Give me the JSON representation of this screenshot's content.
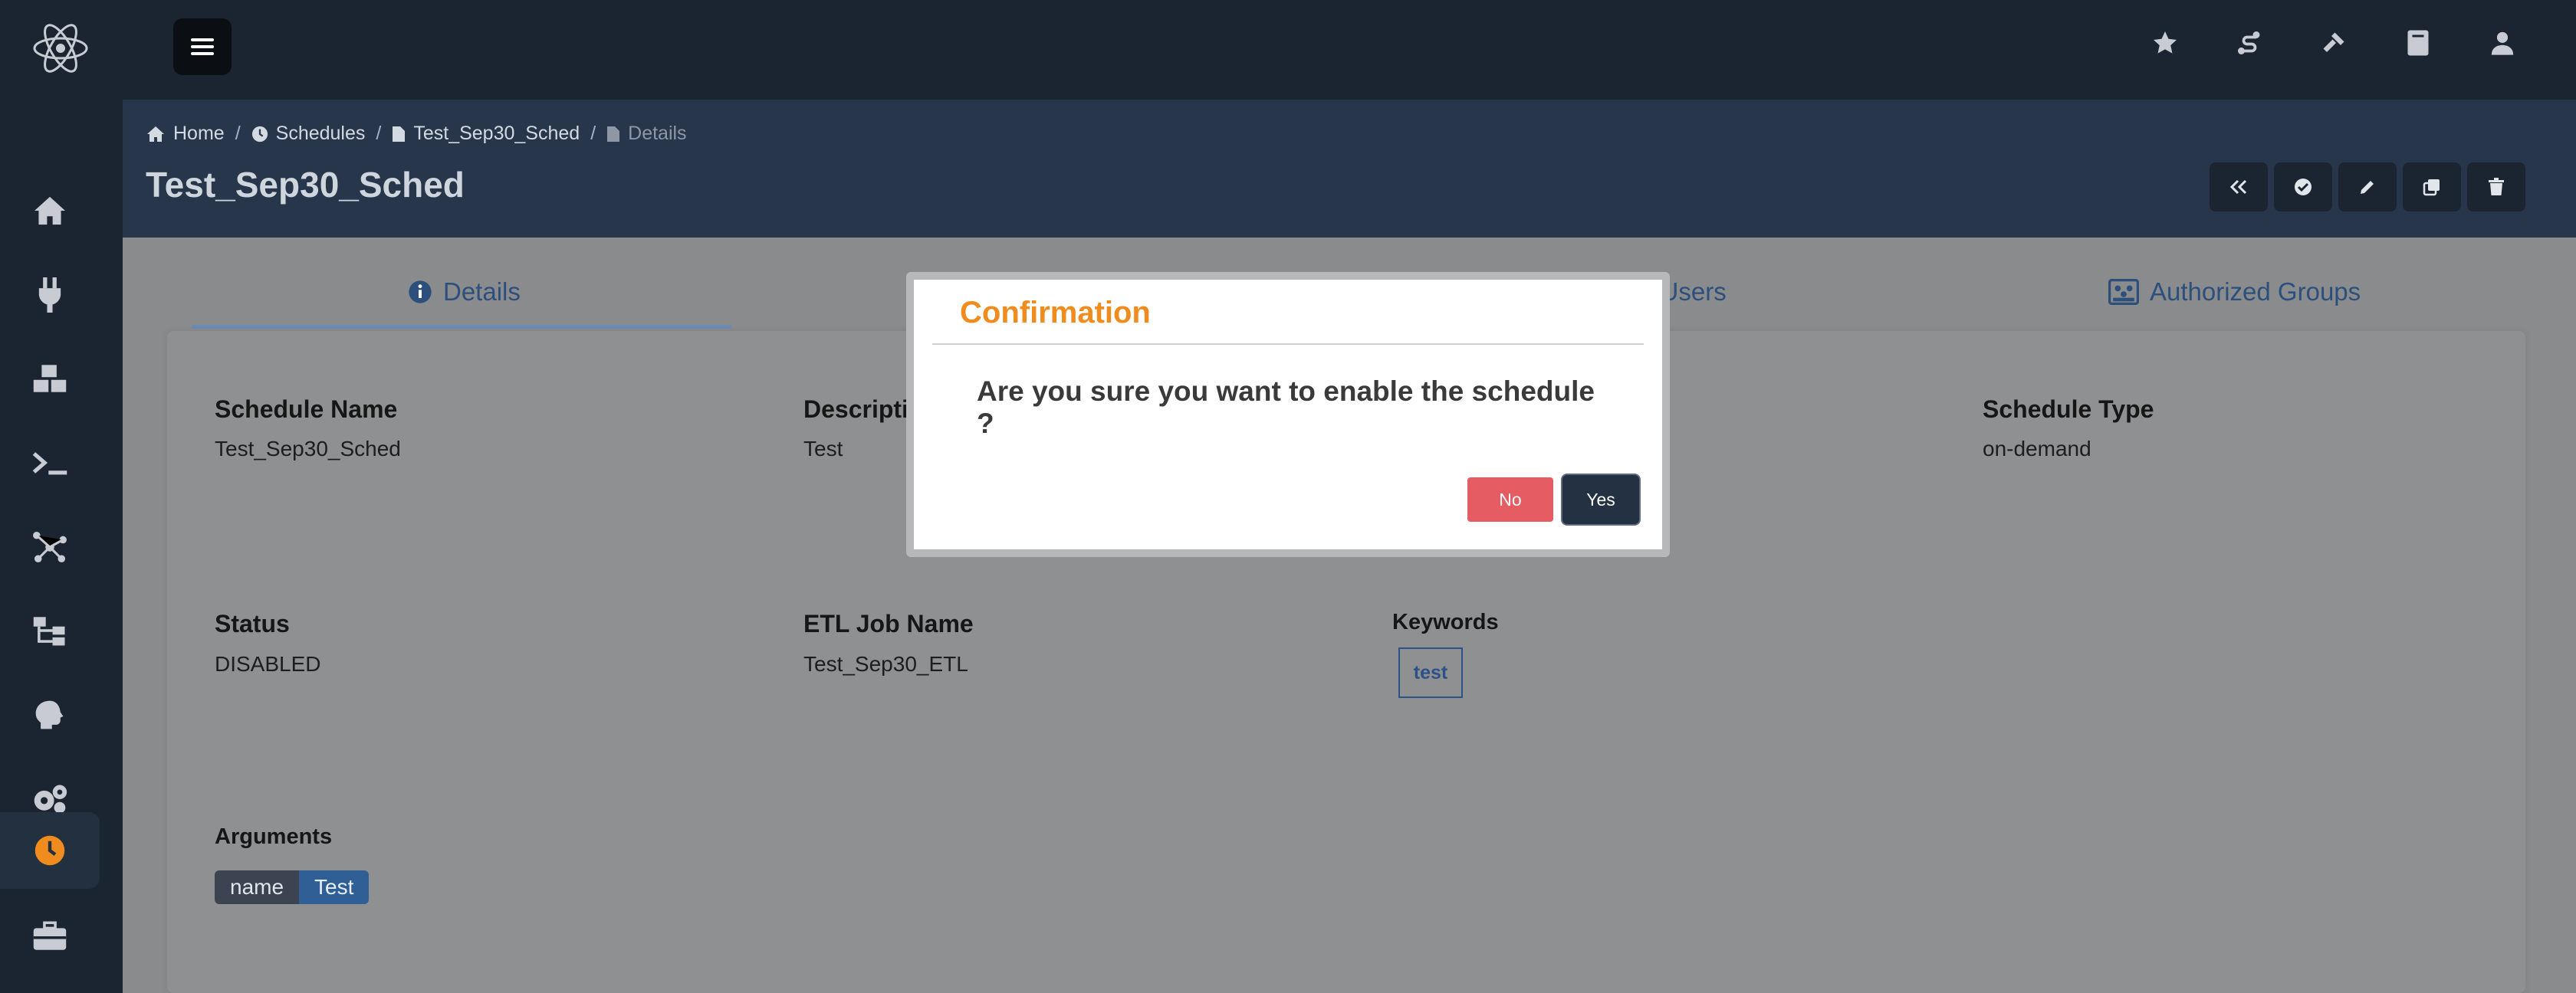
{
  "breadcrumb": {
    "home": "Home",
    "schedules": "Schedules",
    "schedule_name": "Test_Sep30_Sched",
    "current": "Details"
  },
  "page": {
    "title": "Test_Sep30_Sched"
  },
  "tabs": [
    {
      "label": "Details",
      "icon": "info-circle-icon",
      "active": true
    },
    {
      "label": "d Users",
      "icon": "users-icon"
    },
    {
      "label": "Authorized Groups",
      "icon": "groups-icon"
    }
  ],
  "fields": {
    "schedule_name": {
      "label": "Schedule Name",
      "value": "Test_Sep30_Sched"
    },
    "description": {
      "label": "Descripti",
      "value": "Test"
    },
    "schedule_type": {
      "label": "Schedule Type",
      "value": "on-demand"
    },
    "status": {
      "label": "Status",
      "value": "DISABLED"
    },
    "etl_job_name": {
      "label": "ETL Job Name",
      "value": "Test_Sep30_ETL"
    },
    "keywords": {
      "label": "Keywords",
      "items": [
        "test"
      ]
    },
    "arguments": {
      "label": "Arguments",
      "items": [
        {
          "name": "name",
          "value": "Test"
        }
      ]
    }
  },
  "modal": {
    "title": "Confirmation",
    "message_line1": "Are you sure you want to enable the schedule",
    "message_line2": "?",
    "no_label": "No",
    "yes_label": "Yes"
  },
  "colors": {
    "accent_orange": "#f08c1e",
    "no_button": "#e55c62",
    "yes_button": "#233142",
    "tab_blue": "#2c4f7c"
  },
  "icons": {
    "top": [
      "star-icon",
      "route-icon",
      "hammer-icon",
      "book-icon",
      "user-icon"
    ],
    "sidebar": [
      "home-icon",
      "plug-icon",
      "boxes-icon",
      "terminal-icon",
      "network-icon",
      "workflow-icon",
      "brain-icon",
      "gears-icon",
      "clock-icon",
      "briefcase-icon"
    ],
    "actions": [
      "angle-double-left-icon",
      "check-circle-icon",
      "pencil-icon",
      "copy-icon",
      "trash-icon"
    ]
  }
}
